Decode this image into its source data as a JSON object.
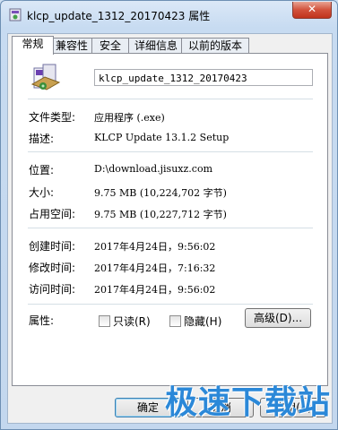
{
  "window": {
    "title": "klcp_update_1312_20170423 属性",
    "close_label": "✕"
  },
  "tabs": [
    {
      "label": "常规",
      "active": true
    },
    {
      "label": "兼容性"
    },
    {
      "label": "安全"
    },
    {
      "label": "详细信息"
    },
    {
      "label": "以前的版本"
    }
  ],
  "general": {
    "file_name": "klcp_update_1312_20170423",
    "file_type_label": "文件类型:",
    "file_type_value": "应用程序 (.exe)",
    "description_label": "描述:",
    "description_value": "KLCP Update 13.1.2 Setup",
    "location_label": "位置:",
    "location_value": "D:\\download.jisuxz.com",
    "size_label": "大小:",
    "size_value": "9.75 MB (10,224,702 字节)",
    "size_on_disk_label": "占用空间:",
    "size_on_disk_value": "9.75 MB (10,227,712 字节)",
    "created_label": "创建时间:",
    "created_value": "2017年4月24日，9:56:02",
    "modified_label": "修改时间:",
    "modified_value": "2017年4月24日，7:16:32",
    "accessed_label": "访问时间:",
    "accessed_value": "2017年4月24日，9:56:02",
    "attributes_label": "属性:",
    "readonly_label": "只读(R)",
    "hidden_label": "隐藏(H)",
    "advanced_label": "高级(D)..."
  },
  "buttons": {
    "ok": "确定",
    "cancel": "取消",
    "apply": "应用(A)"
  },
  "watermark": "极速下载站"
}
